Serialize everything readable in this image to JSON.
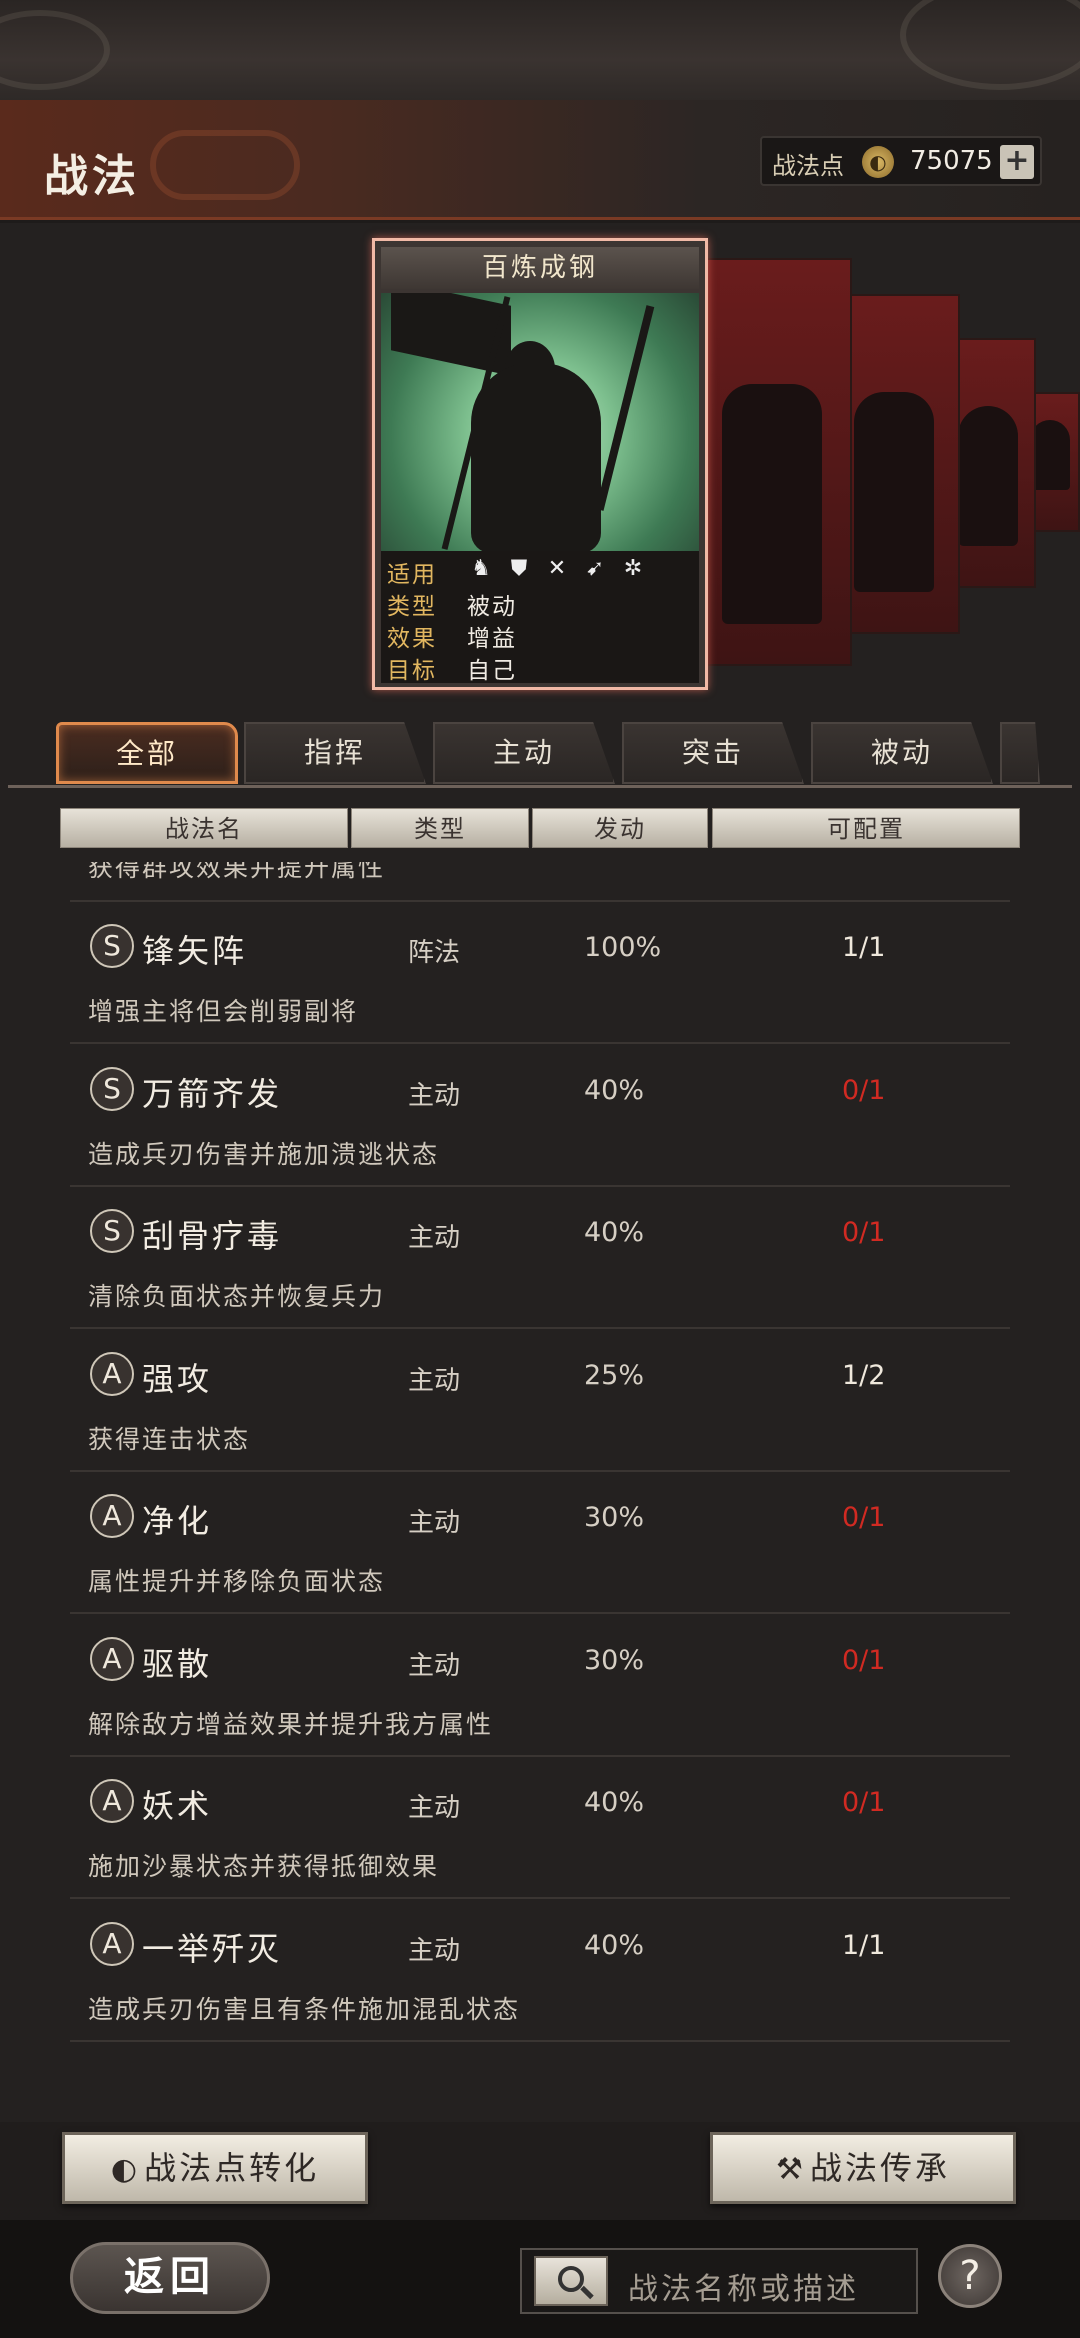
{
  "header": {
    "title": "战法",
    "points_label": "战法点",
    "points_value": "75075",
    "add_label": "+"
  },
  "featured_card": {
    "title": "百炼成钢",
    "rows": [
      {
        "key": "适用",
        "value": ""
      },
      {
        "key": "类型",
        "value": "被动"
      },
      {
        "key": "效果",
        "value": "增益"
      },
      {
        "key": "目标",
        "value": "自己"
      }
    ],
    "troop_icons": [
      "cavalry-icon",
      "shield-icon",
      "bow-icon",
      "spear-icon",
      "wheel-icon"
    ]
  },
  "tabs": [
    {
      "label": "全部",
      "active": true
    },
    {
      "label": "指挥",
      "active": false
    },
    {
      "label": "主动",
      "active": false
    },
    {
      "label": "突击",
      "active": false
    },
    {
      "label": "被动",
      "active": false
    }
  ],
  "columns": [
    "战法名",
    "类型",
    "发动",
    "可配置"
  ],
  "list": {
    "partial_top_desc": "获得群攻效果并提升属性",
    "rows": [
      {
        "grade": "S",
        "name": "锋矢阵",
        "type": "阵法",
        "rate": "100%",
        "config": "1/1",
        "config_red": false,
        "desc": "增强主将但会削弱副将"
      },
      {
        "grade": "S",
        "name": "万箭齐发",
        "type": "主动",
        "rate": "40%",
        "config": "0/1",
        "config_red": true,
        "desc": "造成兵刃伤害并施加溃逃状态"
      },
      {
        "grade": "S",
        "name": "刮骨疗毒",
        "type": "主动",
        "rate": "40%",
        "config": "0/1",
        "config_red": true,
        "desc": "清除负面状态并恢复兵力"
      },
      {
        "grade": "A",
        "name": "强攻",
        "type": "主动",
        "rate": "25%",
        "config": "1/2",
        "config_red": false,
        "desc": "获得连击状态"
      },
      {
        "grade": "A",
        "name": "净化",
        "type": "主动",
        "rate": "30%",
        "config": "0/1",
        "config_red": true,
        "desc": "属性提升并移除负面状态"
      },
      {
        "grade": "A",
        "name": "驱散",
        "type": "主动",
        "rate": "30%",
        "config": "0/1",
        "config_red": true,
        "desc": "解除敌方增益效果并提升我方属性"
      },
      {
        "grade": "A",
        "name": "妖术",
        "type": "主动",
        "rate": "40%",
        "config": "0/1",
        "config_red": true,
        "desc": "施加沙暴状态并获得抵御效果"
      },
      {
        "grade": "A",
        "name": "一举歼灭",
        "type": "主动",
        "rate": "40%",
        "config": "1/1",
        "config_red": false,
        "desc": "造成兵刃伤害且有条件施加混乱状态"
      }
    ]
  },
  "bottom": {
    "convert_label": "战法点转化",
    "inherit_label": "战法传承",
    "back_label": "返回",
    "search_placeholder": "战法名称或描述",
    "help_label": "?"
  },
  "colors": {
    "accent_orange": "#e08a4c",
    "config_red": "#d12a22",
    "gold_key": "#e2b760"
  }
}
